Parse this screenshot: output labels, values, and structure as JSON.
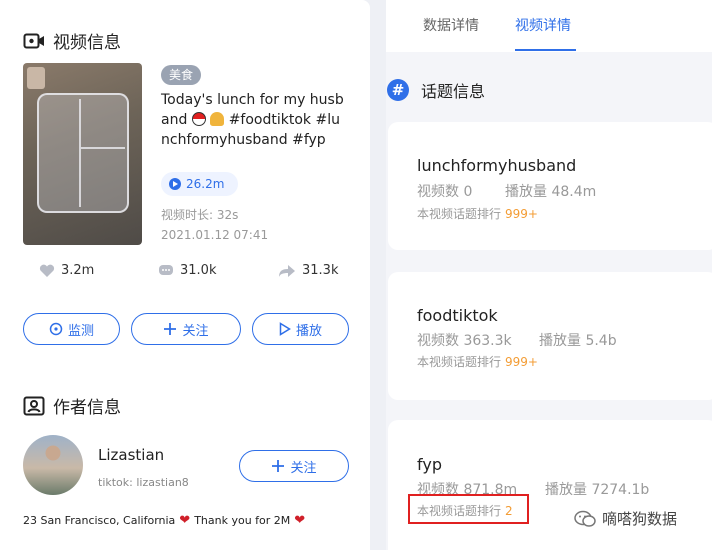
{
  "video_section": {
    "title": "视频信息",
    "tag": "美食",
    "video_title_text": "Today's lunch for my husband",
    "video_title_tail": "#foodtiktok #lunchformyhusband #fyp",
    "views": "26.2m",
    "duration": "视频时长: 32s",
    "date": "2021.01.12 07:41",
    "likes": "3.2m",
    "comments": "31.0k",
    "shares": "31.3k",
    "buttons": {
      "monitor": "监测",
      "follow": "关注",
      "play": "播放"
    }
  },
  "author_section": {
    "title": "作者信息",
    "name": "Lizastian",
    "handle": "tiktok: lizastian8",
    "bio_1": "23 San Francisco, California",
    "bio_2": "Thank you for 2M",
    "follow_label": "关注"
  },
  "tabs": [
    {
      "label": "数据详情",
      "active": false
    },
    {
      "label": "视频详情",
      "active": true
    }
  ],
  "topics_title": "话题信息",
  "topics": [
    {
      "name": "lunchformyhusband",
      "videos": "视频数 0",
      "plays": "播放量 48.4m",
      "rank_label": "本视频话题排行",
      "rank": "999+"
    },
    {
      "name": "foodtiktok",
      "videos": "视频数 363.3k",
      "plays": "播放量 5.4b",
      "rank_label": "本视频话题排行",
      "rank": "999+"
    },
    {
      "name": "fyp",
      "videos": "视频数 871.8m",
      "plays": "播放量 7274.1b",
      "rank_label": "本视频话题排行",
      "rank": "2"
    }
  ],
  "watermark": "嘀嗒狗数据",
  "colors": {
    "accent": "#2f6fe8",
    "rank": "#f39c34",
    "highlight": "#e02020",
    "heart": "#d0202a"
  }
}
